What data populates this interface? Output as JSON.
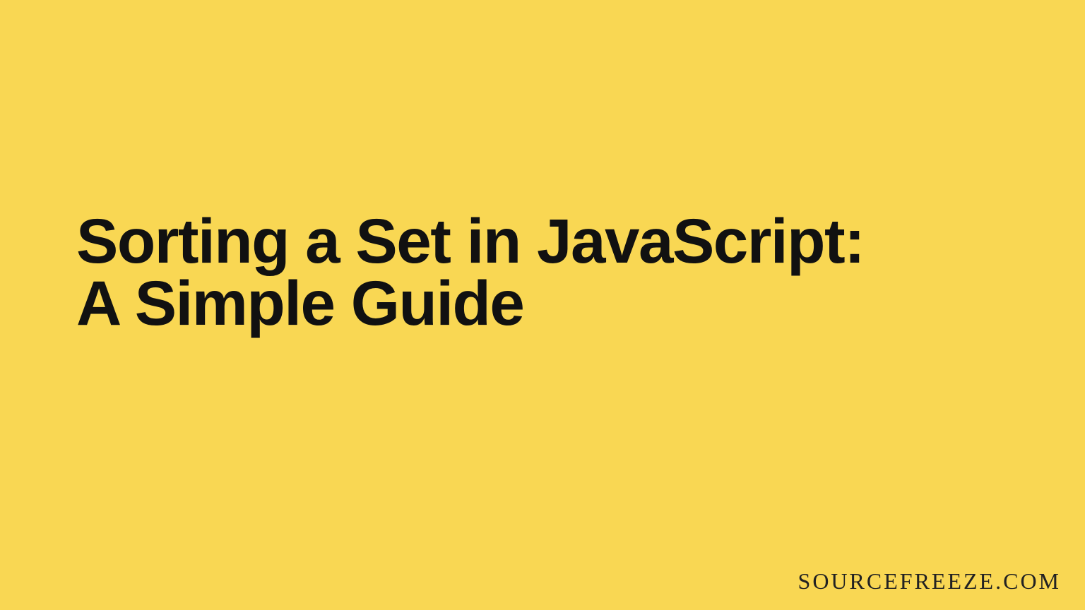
{
  "headline_line1": "Sorting a Set in JavaScript:",
  "headline_line2": "A Simple Guide",
  "watermark": "SOURCEFREEZE.COM",
  "colors": {
    "background": "#f9d753",
    "text": "#111111"
  }
}
